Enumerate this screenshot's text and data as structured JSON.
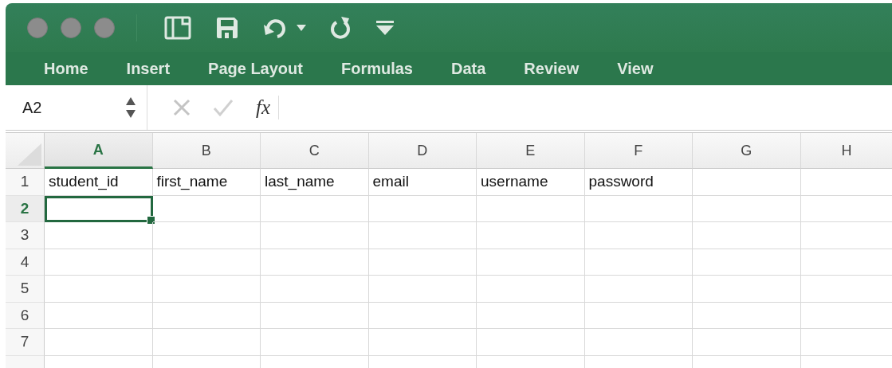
{
  "ribbon_tabs": [
    {
      "label": "Home"
    },
    {
      "label": "Insert"
    },
    {
      "label": "Page Layout"
    },
    {
      "label": "Formulas"
    },
    {
      "label": "Data"
    },
    {
      "label": "Review"
    },
    {
      "label": "View"
    }
  ],
  "formula_bar": {
    "name_box": "A2",
    "function_symbol": "fx"
  },
  "sheet": {
    "columns": [
      {
        "label": "A",
        "selected": true
      },
      {
        "label": "B",
        "selected": false
      },
      {
        "label": "C",
        "selected": false
      },
      {
        "label": "D",
        "selected": false
      },
      {
        "label": "E",
        "selected": false
      },
      {
        "label": "F",
        "selected": false
      },
      {
        "label": "G",
        "selected": false
      },
      {
        "label": "H",
        "selected": false
      }
    ],
    "rows": [
      {
        "number": "1",
        "selected": false,
        "cells": [
          "student_id",
          "first_name",
          "last_name",
          "email",
          "username",
          "password"
        ]
      },
      {
        "number": "2",
        "selected": true
      },
      {
        "number": "3",
        "selected": false
      },
      {
        "number": "4",
        "selected": false
      },
      {
        "number": "5",
        "selected": false
      },
      {
        "number": "6",
        "selected": false
      },
      {
        "number": "7",
        "selected": false
      }
    ]
  }
}
